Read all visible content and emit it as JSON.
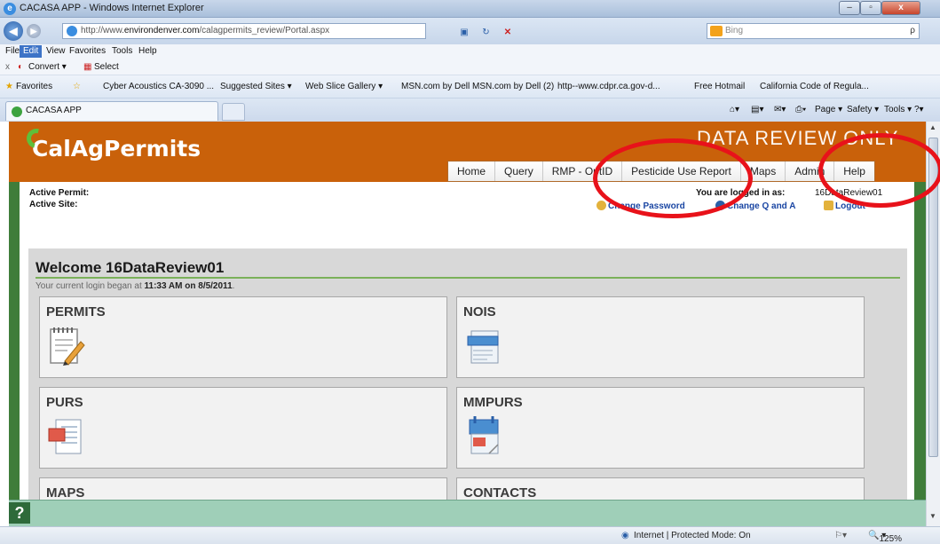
{
  "window": {
    "title": "CACASA APP - Windows Internet Explorer",
    "controls": {
      "minimize": "–",
      "maximize": "▫",
      "close": "x"
    }
  },
  "address_bar": {
    "url_prefix": "http://www.",
    "url_host": "environdenver.com",
    "url_path": "/calagpermits_review/Portal.aspx",
    "search_placeholder": "Bing",
    "search_icon": "ρ"
  },
  "menu": {
    "items": [
      "File",
      "Edit",
      "View",
      "Favorites",
      "Tools",
      "Help"
    ]
  },
  "convert_bar": {
    "close": "x",
    "convert": "Convert ▾",
    "select": "Select"
  },
  "favorites_bar": {
    "label": "Favorites",
    "items": [
      "Cyber Acoustics CA-3090 ...",
      "Suggested Sites ▾",
      "Web Slice Gallery ▾",
      "MSN.com by Dell",
      "MSN.com by Dell (2)",
      "http--www.cdpr.ca.gov-d...",
      "Free Hotmail",
      "California Code of Regula..."
    ]
  },
  "tab": {
    "title": "CACASA APP"
  },
  "command_bar": {
    "page": "Page ▾",
    "safety": "Safety ▾",
    "tools": "Tools ▾",
    "help": "?▾"
  },
  "app": {
    "logo": "CalAgPermits",
    "banner": "DATA REVIEW ONLY",
    "nav": [
      "Home",
      "Query",
      "RMP - OptID",
      "Pesticide Use Report",
      "Maps",
      "Admin",
      "Help"
    ]
  },
  "info": {
    "active_permit_label": "Active Permit:",
    "active_site_label": "Active Site:",
    "logged_in_label": "You are logged in as:",
    "username": "16DataReview01",
    "links": {
      "change_password": "Change Password",
      "change_q_and_a": "Change Q and A",
      "logout": "Logout"
    }
  },
  "welcome": {
    "heading": "Welcome 16DataReview01",
    "since_prefix": "Your current login began at",
    "since_value": "11:33 AM on 8/5/2011",
    "since_suffix": "."
  },
  "tiles": [
    "PERMITS",
    "NOIS",
    "PURS",
    "MMPURS",
    "MAPS",
    "CONTACTS"
  ],
  "help_button": "?",
  "status_bar": {
    "zone": "Internet | Protected Mode: On",
    "zoom": "125%"
  },
  "colors": {
    "header_orange": "#c9610a",
    "frame_green": "#3f7d3a",
    "highlight_red": "#e8121a"
  }
}
